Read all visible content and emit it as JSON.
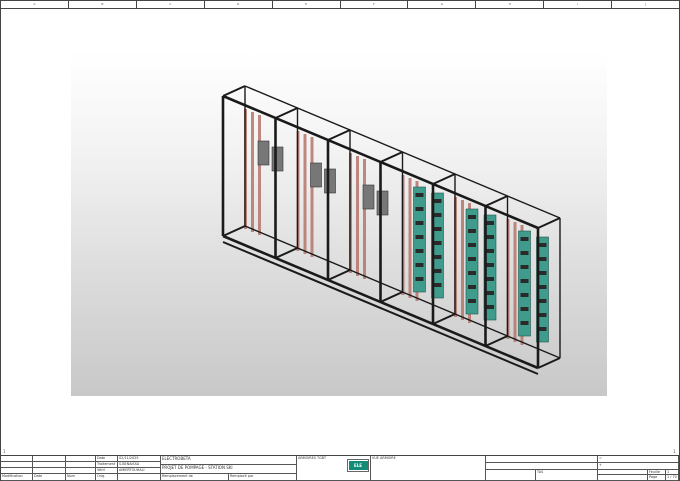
{
  "ruler": {
    "columns": [
      "A",
      "B",
      "C",
      "D",
      "E",
      "F",
      "G",
      "H",
      "I",
      "J"
    ]
  },
  "side_marks": {
    "left": "1",
    "right": "1"
  },
  "view": {
    "title": "VUE ARMOIRE"
  },
  "titleblock": {
    "date_label": "Date",
    "date_value": "02/11/2025",
    "treatment_label": "Traitement",
    "treatment_value": "S.BENAISSA",
    "verif_label": "Vérif.",
    "verif_value": "AMIERTOUHALI",
    "orig_label": "Orig.",
    "modification_label": "Modification",
    "date2_label": "Date",
    "name_label": "Nom",
    "client_label": "ELECTROBETA",
    "project_label": "PROJET DE POMPAGE - STATION SKI",
    "replacement_label": "Remplacement de",
    "replaced_by_label": "Remplacé par",
    "armoire_label": "ARMOIRES TGBT",
    "logo_text": "ELE",
    "view_label": "VUE ARMOIRE",
    "tab_label": "TAS",
    "plus": "+",
    "eq": "=",
    "folio_label": "Feuille",
    "folio_value": "1",
    "page_label": "Page",
    "page_value": "1 / 70"
  },
  "colors": {
    "frame": "#1a1a1a",
    "busbar": "#b5746a",
    "module": "#3f9c8c",
    "breaker": "#777777"
  }
}
